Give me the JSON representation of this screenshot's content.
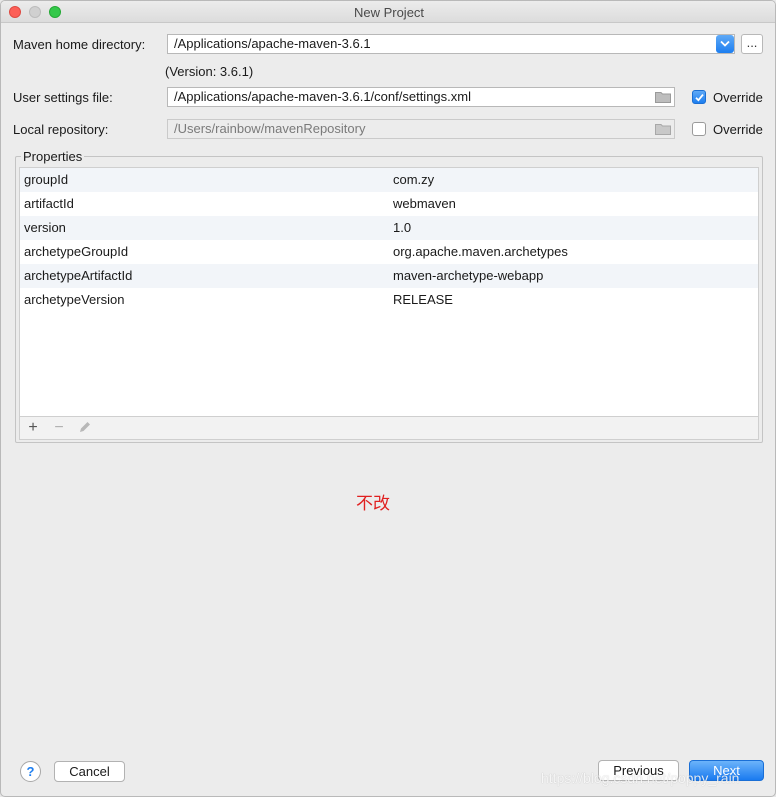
{
  "window": {
    "title": "New Project"
  },
  "maven_home": {
    "label": "Maven home directory:",
    "value": "/Applications/apache-maven-3.6.1",
    "browse_label": "...",
    "version_text": "(Version: 3.6.1)"
  },
  "user_settings": {
    "label": "User settings file:",
    "value": "/Applications/apache-maven-3.6.1/conf/settings.xml",
    "override_label": "Override",
    "override_checked": true
  },
  "local_repo": {
    "label": "Local repository:",
    "value": "/Users/rainbow/mavenRepository",
    "override_label": "Override",
    "override_checked": false
  },
  "properties": {
    "title": "Properties",
    "rows": [
      {
        "key": "groupId",
        "value": "com.zy"
      },
      {
        "key": "artifactId",
        "value": "webmaven"
      },
      {
        "key": "version",
        "value": "1.0"
      },
      {
        "key": "archetypeGroupId",
        "value": "org.apache.maven.archetypes"
      },
      {
        "key": "archetypeArtifactId",
        "value": "maven-archetype-webapp"
      },
      {
        "key": "archetypeVersion",
        "value": "RELEASE"
      }
    ],
    "toolbar": {
      "add": "+",
      "remove": "−"
    }
  },
  "annotation": "不改",
  "footer": {
    "help": "?",
    "cancel": "Cancel",
    "previous": "Previous",
    "next": "Next"
  },
  "watermark": "https://blog.csdn.net/poppy_rain",
  "colors": {
    "accent": "#1d7ef0",
    "annotation": "#e02020"
  }
}
